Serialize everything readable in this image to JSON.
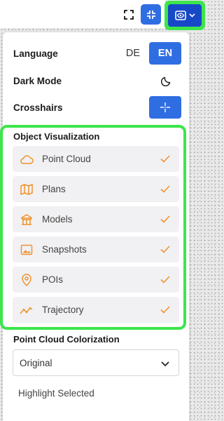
{
  "toolbar": {
    "fullscreen_icon": "fullscreen-icon",
    "collapse_icon": "collapse-icon",
    "visibility_icon": "eye-icon",
    "dropdown_icon": "chevron-down-icon",
    "accent_color": "#2f6de2",
    "active_color": "#1648c8",
    "highlight_color": "#3ce54b"
  },
  "settings": {
    "language_label": "Language",
    "language_options": [
      "DE",
      "EN"
    ],
    "language_selected": "EN",
    "dark_mode_label": "Dark Mode",
    "dark_mode_icon": "moon-icon",
    "crosshairs_label": "Crosshairs",
    "crosshairs_icon": "crosshair-icon",
    "crosshairs_enabled": true
  },
  "object_visualization": {
    "title": "Object Visualization",
    "icon_color": "#f0922e",
    "items": [
      {
        "label": "Point Cloud",
        "icon": "cloud-icon",
        "checked": true
      },
      {
        "label": "Plans",
        "icon": "map-icon",
        "checked": true
      },
      {
        "label": "Models",
        "icon": "building-icon",
        "checked": true
      },
      {
        "label": "Snapshots",
        "icon": "image-icon",
        "checked": true
      },
      {
        "label": "POIs",
        "icon": "map-pin-icon",
        "checked": true
      },
      {
        "label": "Trajectory",
        "icon": "trajectory-icon",
        "checked": true
      }
    ]
  },
  "colorization": {
    "title": "Point Cloud Colorization",
    "selected": "Original"
  },
  "highlight": {
    "label": "Highlight Selected"
  }
}
